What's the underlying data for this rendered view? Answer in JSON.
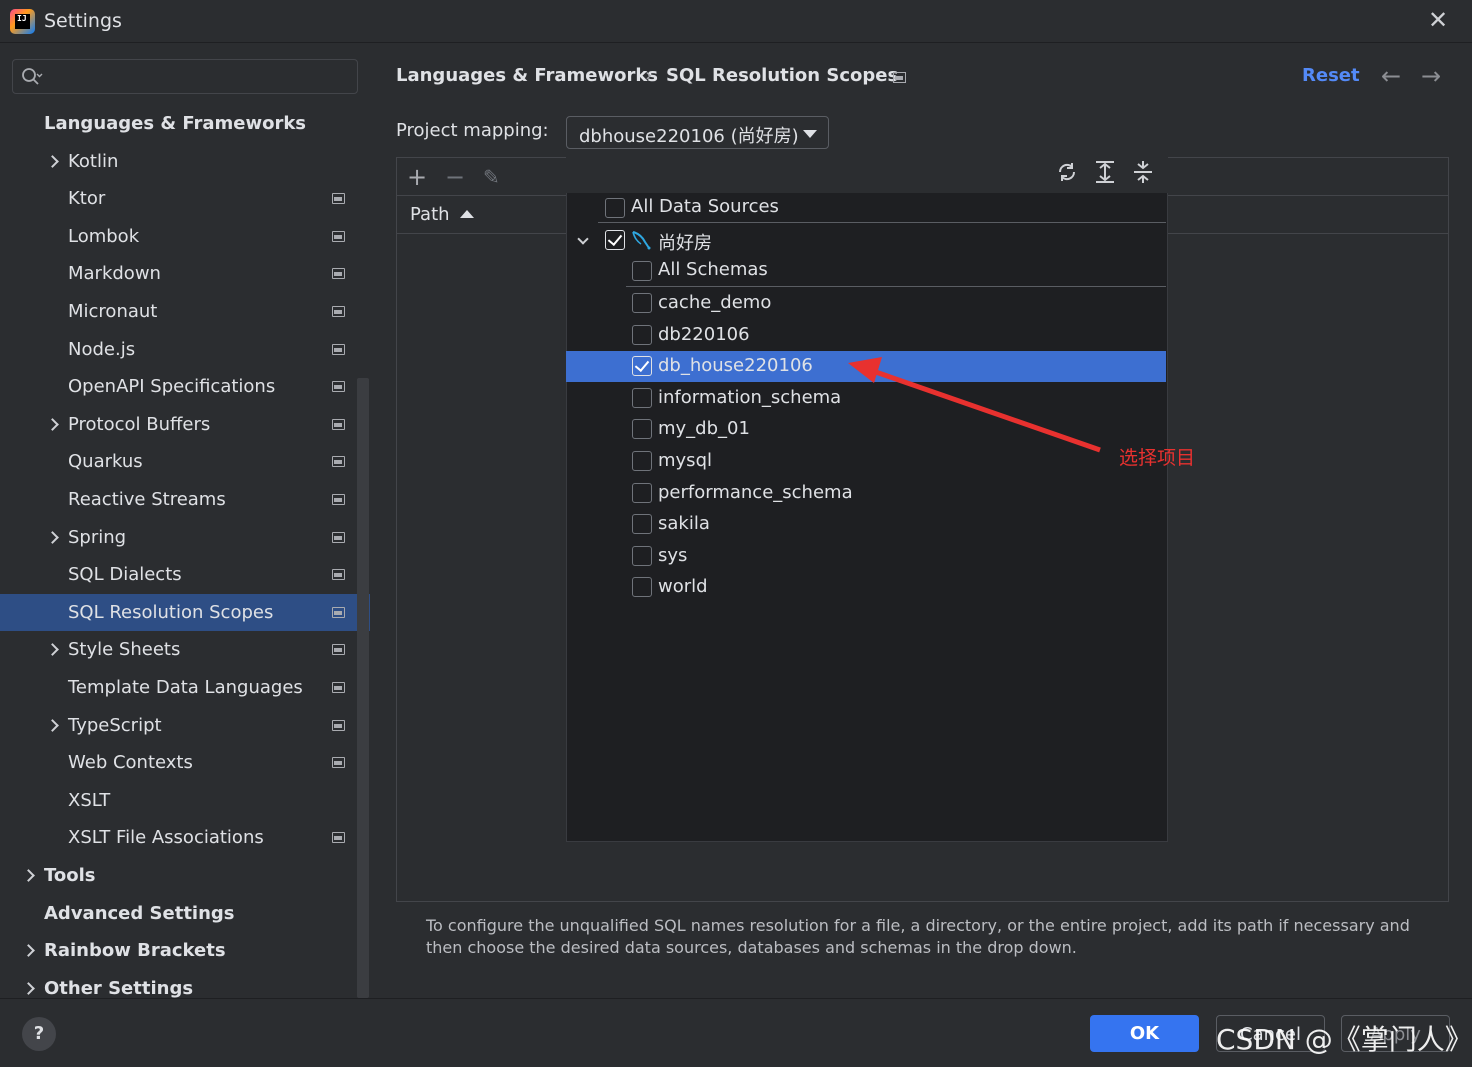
{
  "window": {
    "title": "Settings"
  },
  "search": {
    "placeholder": ""
  },
  "sidebar": {
    "items": [
      {
        "label": "Languages & Frameworks",
        "level": 0,
        "bold": true,
        "chevron": false,
        "project_icon": false
      },
      {
        "label": "Kotlin",
        "level": 1,
        "chevron": true,
        "project_icon": false
      },
      {
        "label": "Ktor",
        "level": 1,
        "chevron": false,
        "project_icon": true
      },
      {
        "label": "Lombok",
        "level": 1,
        "chevron": false,
        "project_icon": true
      },
      {
        "label": "Markdown",
        "level": 1,
        "chevron": false,
        "project_icon": true
      },
      {
        "label": "Micronaut",
        "level": 1,
        "chevron": false,
        "project_icon": true
      },
      {
        "label": "Node.js",
        "level": 1,
        "chevron": false,
        "project_icon": true
      },
      {
        "label": "OpenAPI Specifications",
        "level": 1,
        "chevron": false,
        "project_icon": true
      },
      {
        "label": "Protocol Buffers",
        "level": 1,
        "chevron": true,
        "project_icon": true
      },
      {
        "label": "Quarkus",
        "level": 1,
        "chevron": false,
        "project_icon": true
      },
      {
        "label": "Reactive Streams",
        "level": 1,
        "chevron": false,
        "project_icon": true
      },
      {
        "label": "Spring",
        "level": 1,
        "chevron": true,
        "project_icon": true
      },
      {
        "label": "SQL Dialects",
        "level": 1,
        "chevron": false,
        "project_icon": true
      },
      {
        "label": "SQL Resolution Scopes",
        "level": 1,
        "chevron": false,
        "project_icon": true,
        "selected": true
      },
      {
        "label": "Style Sheets",
        "level": 1,
        "chevron": true,
        "project_icon": true
      },
      {
        "label": "Template Data Languages",
        "level": 1,
        "chevron": false,
        "project_icon": true
      },
      {
        "label": "TypeScript",
        "level": 1,
        "chevron": true,
        "project_icon": true
      },
      {
        "label": "Web Contexts",
        "level": 1,
        "chevron": false,
        "project_icon": true
      },
      {
        "label": "XSLT",
        "level": 1,
        "chevron": false,
        "project_icon": false
      },
      {
        "label": "XSLT File Associations",
        "level": 1,
        "chevron": false,
        "project_icon": true
      },
      {
        "label": "Tools",
        "level": 0,
        "bold": true,
        "chevron": true,
        "project_icon": false
      },
      {
        "label": "Advanced Settings",
        "level": 0,
        "bold": true,
        "chevron": false,
        "project_icon": false
      },
      {
        "label": "Rainbow Brackets",
        "level": 0,
        "bold": true,
        "chevron": true,
        "project_icon": false
      },
      {
        "label": "Other Settings",
        "level": 0,
        "bold": true,
        "chevron": true,
        "project_icon": false
      }
    ]
  },
  "header": {
    "breadcrumb_parent": "Languages & Frameworks",
    "breadcrumb_sep": "›",
    "breadcrumb_current": "SQL Resolution Scopes",
    "reset_label": "Reset",
    "back_icon": "arrow-left-icon",
    "forward_icon": "arrow-right-icon"
  },
  "project_mapping": {
    "label": "Project mapping:",
    "value": "dbhouse220106 (尚好房)"
  },
  "table": {
    "toolbar": [
      "add-icon",
      "remove-icon",
      "edit-icon"
    ],
    "column_header": "Path"
  },
  "popup": {
    "tools": [
      "refresh-icon",
      "expand-all-icon",
      "collapse-all-icon"
    ],
    "all_data_sources": {
      "label": "All Data Sources",
      "checked": false
    },
    "datasource": {
      "label": "尚好房",
      "checked": true,
      "icon": "mysql-dolphin-icon"
    },
    "all_schemas": {
      "label": "All Schemas",
      "checked": false
    },
    "schemas": [
      {
        "label": "cache_demo",
        "checked": false
      },
      {
        "label": "db220106",
        "checked": false
      },
      {
        "label": "db_house220106",
        "checked": true,
        "selected": true
      },
      {
        "label": "information_schema",
        "checked": false
      },
      {
        "label": "my_db_01",
        "checked": false
      },
      {
        "label": "mysql",
        "checked": false
      },
      {
        "label": "performance_schema",
        "checked": false
      },
      {
        "label": "sakila",
        "checked": false
      },
      {
        "label": "sys",
        "checked": false
      },
      {
        "label": "world",
        "checked": false
      }
    ]
  },
  "annotation": {
    "text": "选择项目",
    "color": "#e8312f"
  },
  "help_text": "To configure the unqualified SQL names resolution for a file, a directory, or the entire project, add its path if necessary and then choose the desired data sources, databases and schemas in the drop down.",
  "footer": {
    "help_label": "?",
    "ok_label": "OK",
    "cancel_label": "Cancel",
    "apply_label": "Apply",
    "watermark": "CSDN @《掌门人》"
  },
  "colors": {
    "accent": "#3574f0",
    "selection": "#2e4e85",
    "popup_selection": "#3d6fd1",
    "link": "#548af7"
  }
}
